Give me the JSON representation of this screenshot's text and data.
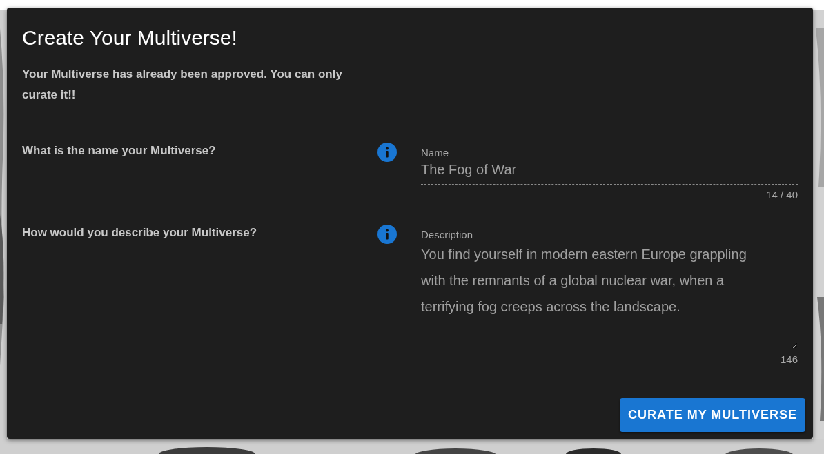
{
  "dialog": {
    "title": "Create Your Multiverse!",
    "notice": "Your Multiverse has already been approved. You can only curate it!!",
    "questions": [
      {
        "prompt": "What is the name your Multiverse?",
        "field": {
          "kind": "text",
          "label": "Name",
          "value": "The Fog of War",
          "counter": "14 / 40",
          "disabled": true
        }
      },
      {
        "prompt": "How would you describe your Multiverse?",
        "field": {
          "kind": "textarea",
          "label": "Description",
          "value": "You find yourself in modern eastern Europe grappling with the remnants of a global nuclear war, when a terrifying fog creeps across the landscape.",
          "counter": "146",
          "disabled": true
        }
      }
    ],
    "submit_button": "CURATE MY MULTIVERSE"
  }
}
